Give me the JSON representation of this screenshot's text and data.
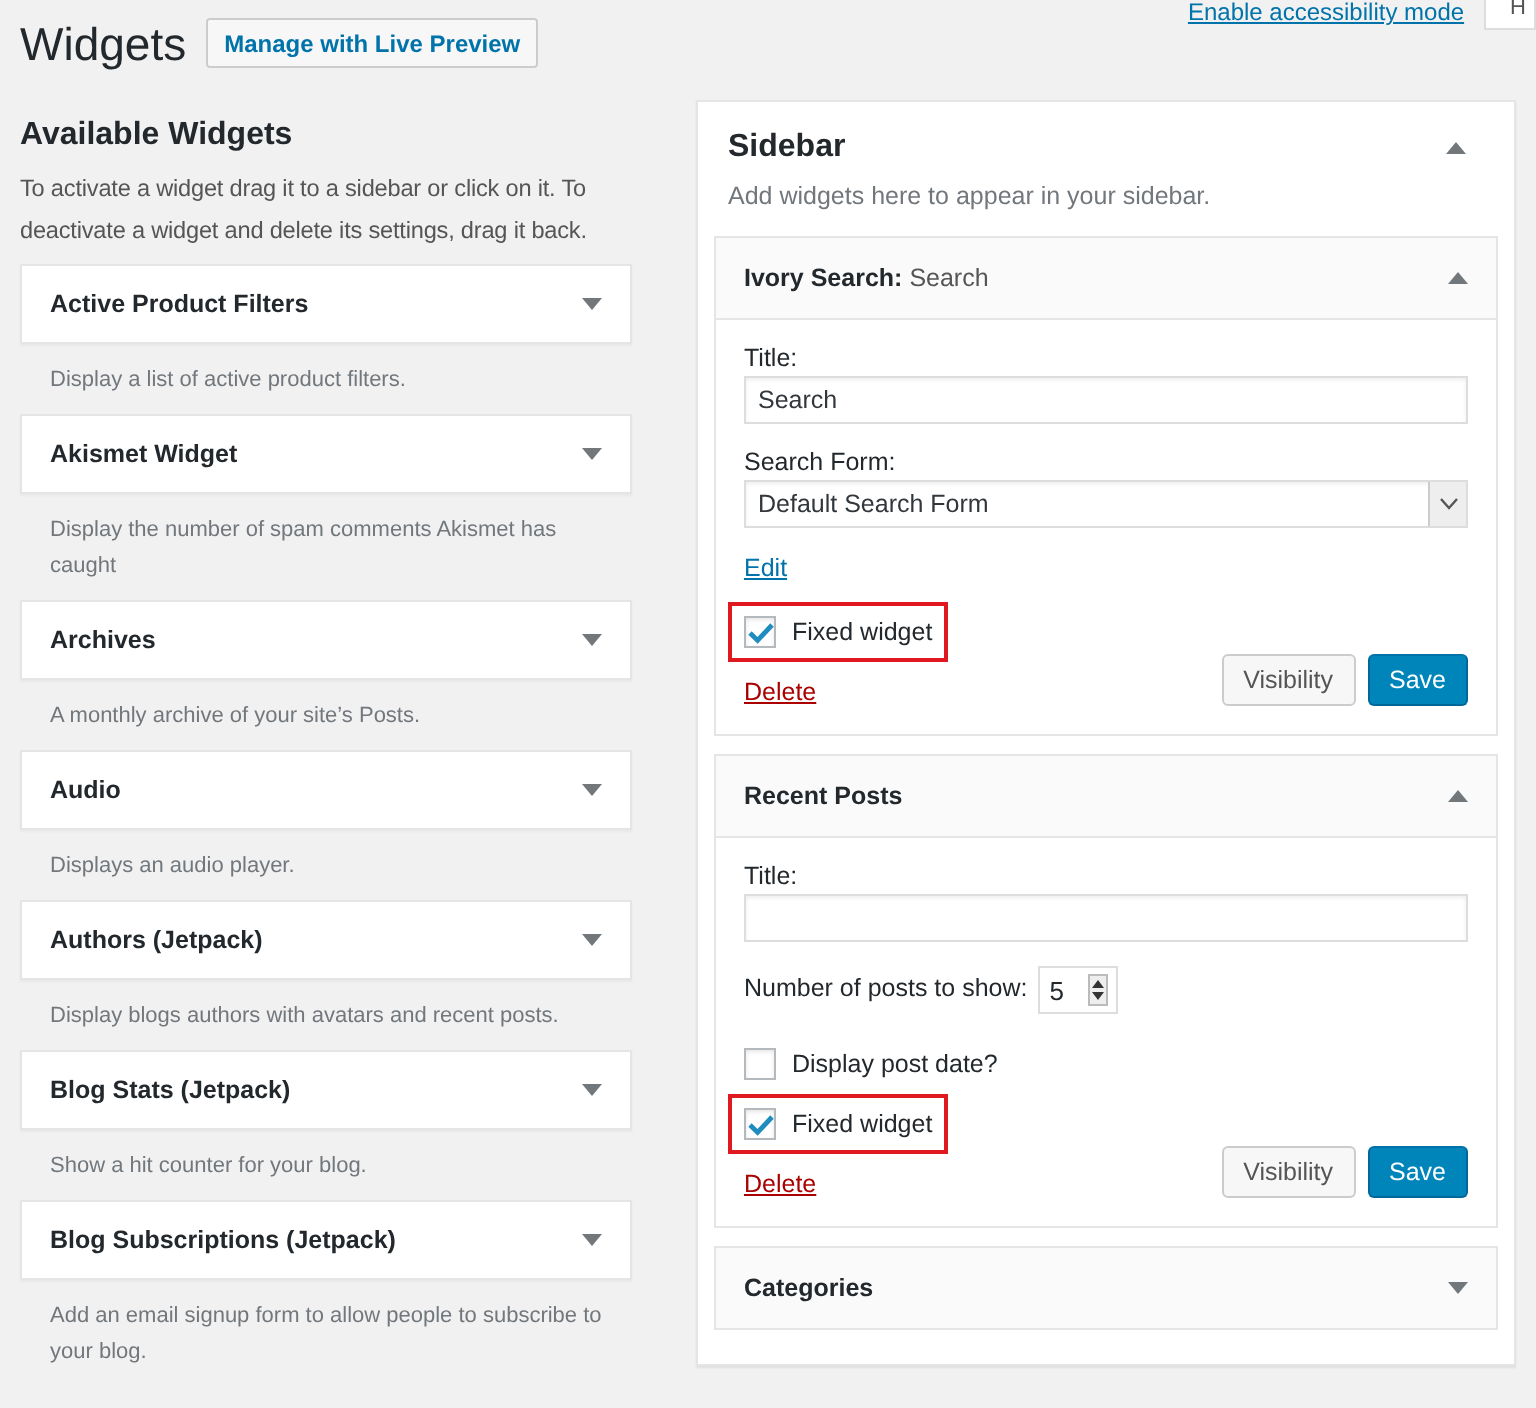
{
  "header": {
    "title": "Widgets",
    "action": "Manage with Live Preview",
    "accessibility_link": "Enable accessibility mode",
    "help_tab": "H"
  },
  "available": {
    "title": "Available Widgets",
    "description": "To activate a widget drag it to a sidebar or click on it. To deactivate a widget and delete its settings, drag it back.",
    "widgets": [
      {
        "name": "Active Product Filters",
        "description": "Display a list of active product filters."
      },
      {
        "name": "Akismet Widget",
        "description": "Display the number of spam comments Akismet has caught"
      },
      {
        "name": "Archives",
        "description": "A monthly archive of your site’s Posts."
      },
      {
        "name": "Audio",
        "description": "Displays an audio player."
      },
      {
        "name": "Authors (Jetpack)",
        "description": "Display blogs authors with avatars and recent posts."
      },
      {
        "name": "Blog Stats (Jetpack)",
        "description": "Show a hit counter for your blog."
      },
      {
        "name": "Blog Subscriptions (Jetpack)",
        "description": "Add an email signup form to allow people to subscribe to your blog."
      }
    ]
  },
  "sidebar": {
    "title": "Sidebar",
    "expanded": true,
    "description": "Add widgets here to appear in your sidebar.",
    "widgets": [
      {
        "title": "**Ivory Search:** Search",
        "expanded": true,
        "fields": [
          {
            "kind": "text",
            "label": "Title:",
            "value": "Search"
          },
          {
            "kind": "select",
            "label": "Search Form:",
            "value": "Default Search Form"
          },
          {
            "kind": "link",
            "label": "Edit"
          },
          {
            "kind": "checkbox",
            "label": "Fixed widget",
            "checked": true,
            "highlighted": true
          }
        ],
        "delete": "Delete",
        "buttons": [
          {
            "kind": "secondary",
            "label": "Visibility"
          },
          {
            "kind": "primary",
            "label": "Save"
          }
        ]
      },
      {
        "title": "**Recent Posts**",
        "expanded": true,
        "fields": [
          {
            "kind": "text",
            "label": "Title:"
          },
          {
            "kind": "number",
            "label": "Number of posts to show:",
            "value": "5"
          },
          {
            "kind": "checkbox",
            "label": "Display post date?",
            "checked": false,
            "highlighted": false
          },
          {
            "kind": "checkbox",
            "label": "Fixed widget",
            "checked": true,
            "highlighted": true
          }
        ],
        "delete": "Delete",
        "buttons": [
          {
            "kind": "secondary",
            "label": "Visibility"
          },
          {
            "kind": "primary",
            "label": "Save"
          }
        ]
      },
      {
        "title": "**Categories**",
        "expanded": false
      }
    ]
  }
}
